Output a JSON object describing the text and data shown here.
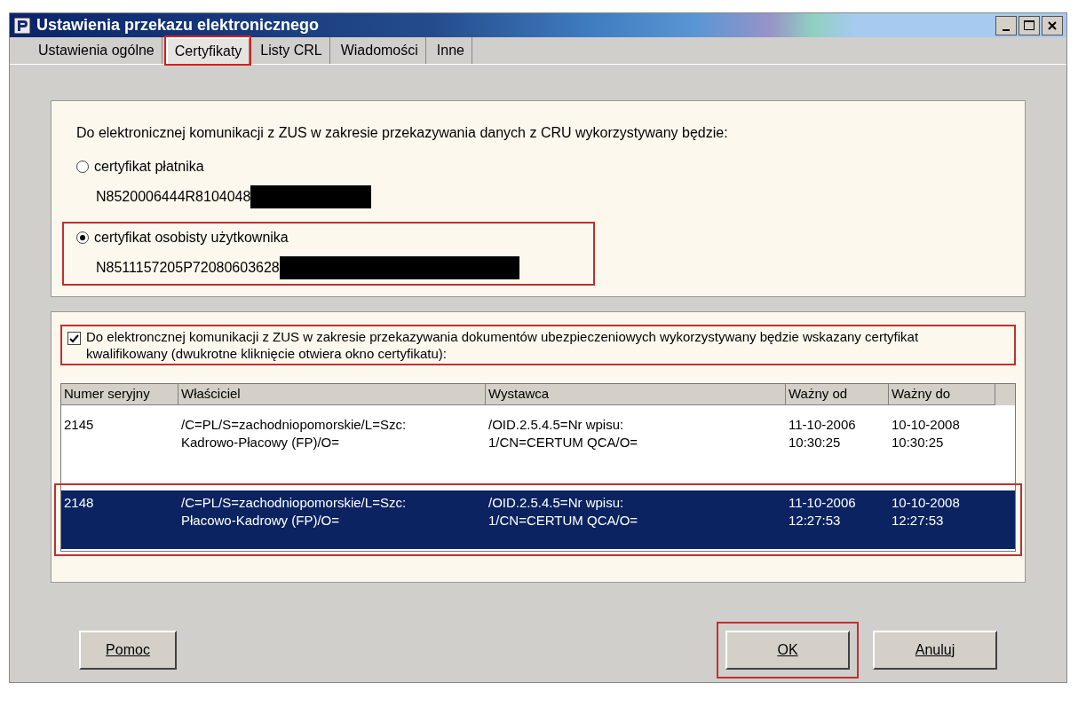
{
  "window": {
    "title": "Ustawienia przekazu elektronicznego"
  },
  "tabs": [
    {
      "label": "Ustawienia ogólne",
      "selected": false,
      "highlighted": false
    },
    {
      "label": "Certyfikaty",
      "selected": true,
      "highlighted": true
    },
    {
      "label": "Listy CRL",
      "selected": false,
      "highlighted": false
    },
    {
      "label": "Wiadomości",
      "selected": false,
      "highlighted": false
    },
    {
      "label": "Inne",
      "selected": false,
      "highlighted": false
    }
  ],
  "cru_section": {
    "prompt": "Do elektronicznej komunikacji z ZUS w zakresie przekazywania danych z CRU wykorzystywany będzie:",
    "options": [
      {
        "label": "certyfikat płatnika",
        "value": "N8520006444R8104048",
        "redacted": true,
        "selected": false,
        "highlighted": false
      },
      {
        "label": "certyfikat osobisty użytkownika",
        "value": "N8511157205P72080603628",
        "redacted": true,
        "selected": true,
        "highlighted": true
      }
    ]
  },
  "qualified_section": {
    "checkbox": {
      "label": "Do elektroncznej komunikacji z ZUS w zakresie przekazywania dokumentów ubezpieczeniowych wykorzystywany będzie wskazany certyfikat kwalifikowany (dwukrotne kliknięcie otwiera okno certyfikatu):",
      "checked": true,
      "highlighted": true
    },
    "table": {
      "columns": [
        "Numer seryjny",
        "Właściciel",
        "Wystawca",
        "Ważny od",
        "Ważny do"
      ],
      "rows": [
        {
          "cells": [
            "2145",
            "/C=PL/S=zachodniopomorskie/L=Szc:\nKadrowo-Płacowy (FP)/O=",
            "/OID.2.5.4.5=Nr wpisu:\n1/CN=CERTUM QCA/O=",
            "11-10-2006\n10:30:25",
            "10-10-2008\n10:30:25"
          ],
          "selected": false,
          "highlighted": false
        },
        {
          "cells": [
            "2148",
            "/C=PL/S=zachodniopomorskie/L=Szc:\nPłacowo-Kadrowy (FP)/O=",
            "/OID.2.5.4.5=Nr wpisu:\n1/CN=CERTUM QCA/O=",
            "11-10-2006\n12:27:53",
            "10-10-2008\n12:27:53"
          ],
          "selected": true,
          "highlighted": true
        }
      ]
    }
  },
  "buttons": [
    {
      "label": "Pomoc",
      "kind": "left",
      "highlighted": false
    },
    {
      "label": "OK",
      "kind": "right",
      "highlighted": true
    },
    {
      "label": "Anuluj",
      "kind": "right",
      "highlighted": false
    }
  ]
}
